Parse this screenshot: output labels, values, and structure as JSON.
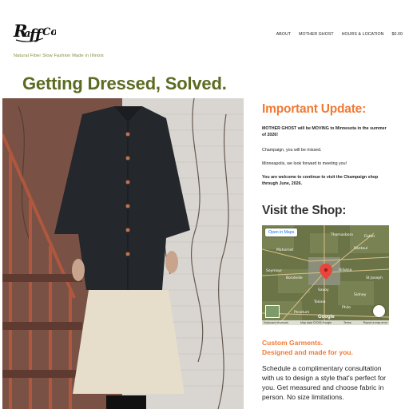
{
  "header": {
    "logo_text": "RaffCo",
    "tagline": "Natural Fiber Slow Fashion Made in Illinois",
    "nav": [
      {
        "label": "ABOUT"
      },
      {
        "label": "MOTHER GHOST"
      },
      {
        "label": "HOURS & LOCATION"
      },
      {
        "label": "$0.00"
      }
    ]
  },
  "hero": {
    "title": "Getting Dressed, Solved."
  },
  "update": {
    "title": "Important Update:",
    "paragraphs": [
      "MOTHER GHOST will be MOVING to Minnesota in the summer of 2026!",
      "Champaign, you will be missed.",
      "Minneapolis, we look forward to meeting you!",
      "You are welcome to continue to visit the Champaign shop through June, 2026."
    ]
  },
  "visit": {
    "title": "Visit the Shop:",
    "map": {
      "open_label": "Open in Maps",
      "places": [
        "Thomasboro",
        "Fisher",
        "Mahomet",
        "Rantoul",
        "Seymour",
        "Bondville",
        "Urbana",
        "Savoy",
        "St Joseph",
        "Tolono",
        "Sidney",
        "Pesotum",
        "Philo"
      ],
      "attribution": [
        "Keyboard shortcuts",
        "Map data ©2026 Google",
        "Terms",
        "Report a map error"
      ],
      "google": "Google"
    }
  },
  "custom": {
    "title_line1": "Custom Garments.",
    "title_line2": "Designed and made for you.",
    "body": "Schedule a complimentary consultation with us to design a style that's perfect for you. Get measured and choose fabric in person. No size limitations."
  },
  "colors": {
    "accent_olive": "#5a6b22",
    "accent_orange": "#f07a34",
    "tagline": "#7f8a3a"
  }
}
